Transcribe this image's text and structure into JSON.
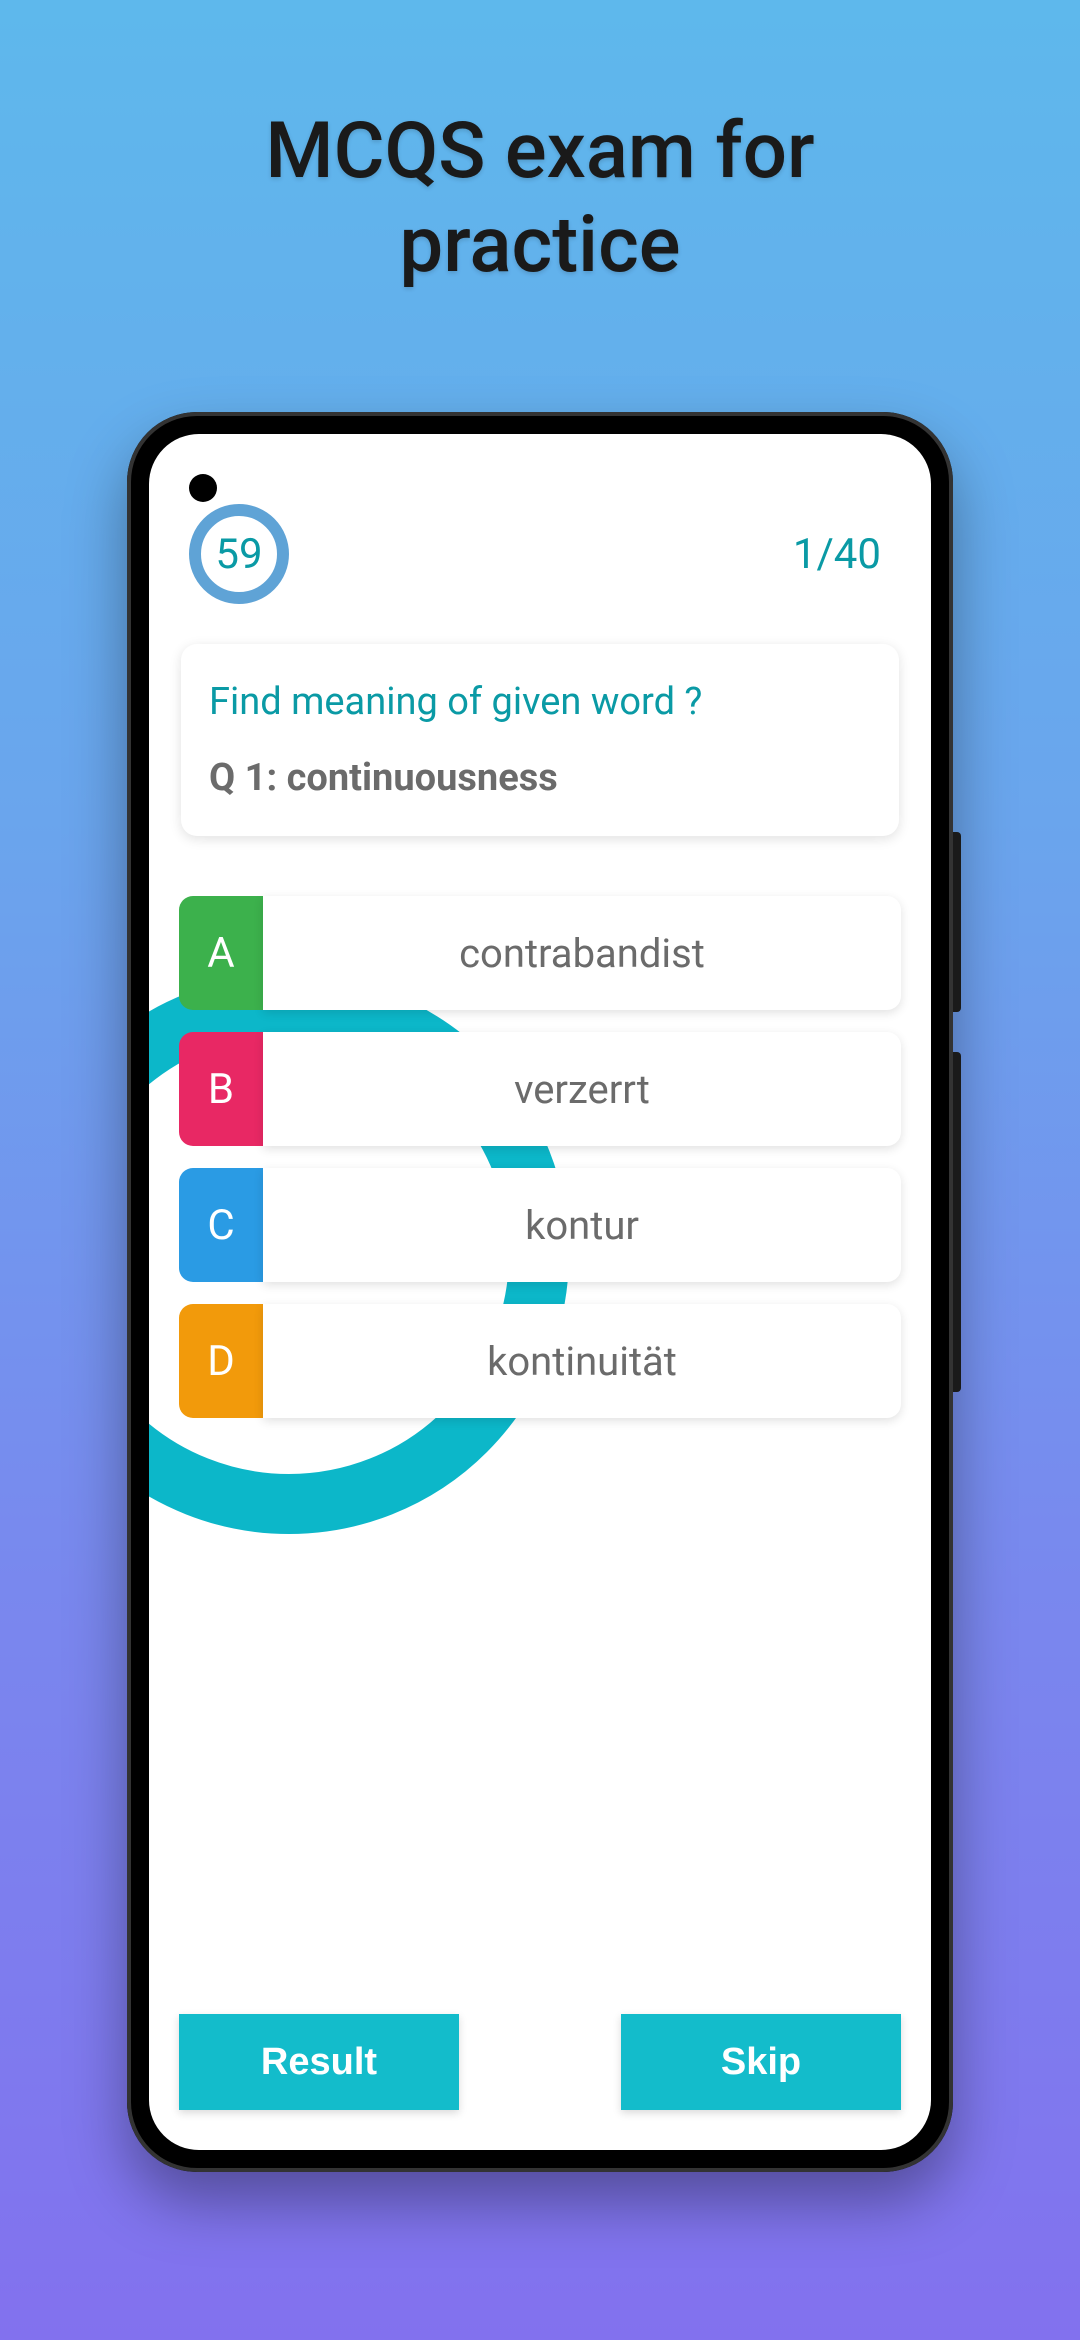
{
  "promo": {
    "title_line1": "MCQS exam for",
    "title_line2": "practice"
  },
  "quiz": {
    "timer": "59",
    "counter": "1/40",
    "prompt": "Find meaning of given word ?",
    "question_label": "Q 1: continuousness",
    "options": {
      "a": {
        "letter": "A",
        "text": "contrabandist"
      },
      "b": {
        "letter": "B",
        "text": "verzerrt"
      },
      "c": {
        "letter": "C",
        "text": "kontur"
      },
      "d": {
        "letter": "D",
        "text": "kontinuität"
      }
    },
    "buttons": {
      "result": "Result",
      "skip": "Skip"
    }
  }
}
